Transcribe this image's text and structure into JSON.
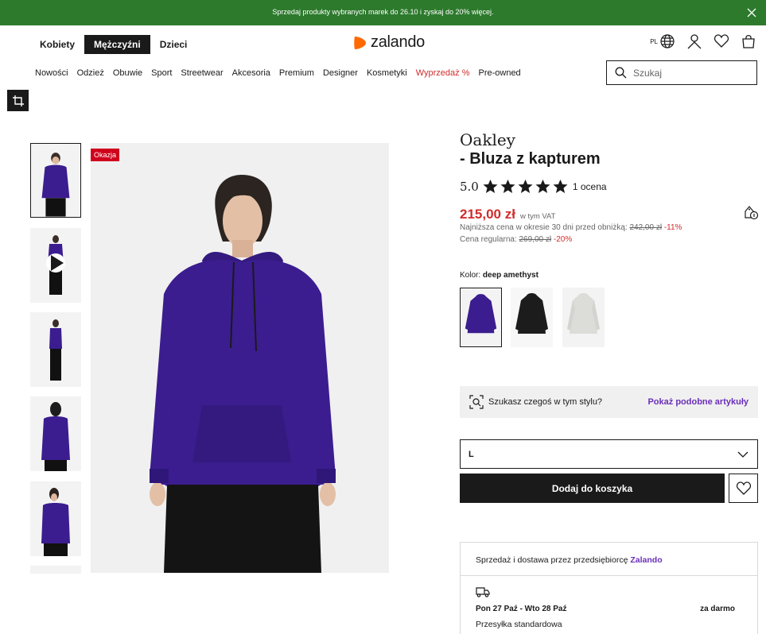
{
  "banner": {
    "text": "Sprzedaj produkty wybranych marek do 26.10 i zyskaj do 20% więcej.",
    "color": "#2d7a2d"
  },
  "header": {
    "gender_tabs": [
      "Kobiety",
      "Mężczyźni",
      "Dzieci"
    ],
    "active_gender": "Mężczyźni",
    "logo_text": "zalando",
    "lang": "PL",
    "brand_color": "#ff6900"
  },
  "nav": {
    "items": [
      "Nowości",
      "Odzież",
      "Obuwie",
      "Sport",
      "Streetwear",
      "Akcesoria",
      "Premium",
      "Designer",
      "Kosmetyki",
      "Wyprzedaż %",
      "Pre-owned"
    ],
    "sale_color": "#d12c2c"
  },
  "search": {
    "placeholder": "Szukaj"
  },
  "gallery": {
    "badge": "Okazja",
    "thumbnails": [
      "front",
      "video",
      "full-side",
      "back",
      "side"
    ]
  },
  "product": {
    "brand": "Oakley",
    "name": "- Bluza z kapturem",
    "rating_value": "5.0",
    "rating_stars": 5,
    "rating_count": "1 ocena",
    "price": "215,00 zł",
    "vat": "w tym VAT",
    "lowest_prefix": "Najniższa cena w okresie 30 dni przed obniżką: ",
    "lowest_price": "242,00 zł",
    "lowest_discount": "-11%",
    "regular_prefix": "Cena regularna: ",
    "regular_price": "269,00 zł",
    "regular_discount": "-20%",
    "color_prefix": "Kolor: ",
    "color_name": "deep amethyst",
    "swatches": [
      "#3b1d8f",
      "#1c1c1c",
      "#dcdcd8"
    ]
  },
  "similar": {
    "question": "Szukasz czegoś w tym stylu?",
    "link": "Pokaż podobne artykuły"
  },
  "size": {
    "selected": "L"
  },
  "cart": {
    "add_label": "Dodaj do koszyka"
  },
  "delivery": {
    "seller_prefix": "Sprzedaż i dostawa przez przedsiębiorcę ",
    "seller_name": "Zalando",
    "dates": "Pon 27 Paź - Wto 28 Paź",
    "price": "za darmo",
    "method": "Przesyłka standardowa"
  },
  "accent_purple": "#6a2fb8"
}
